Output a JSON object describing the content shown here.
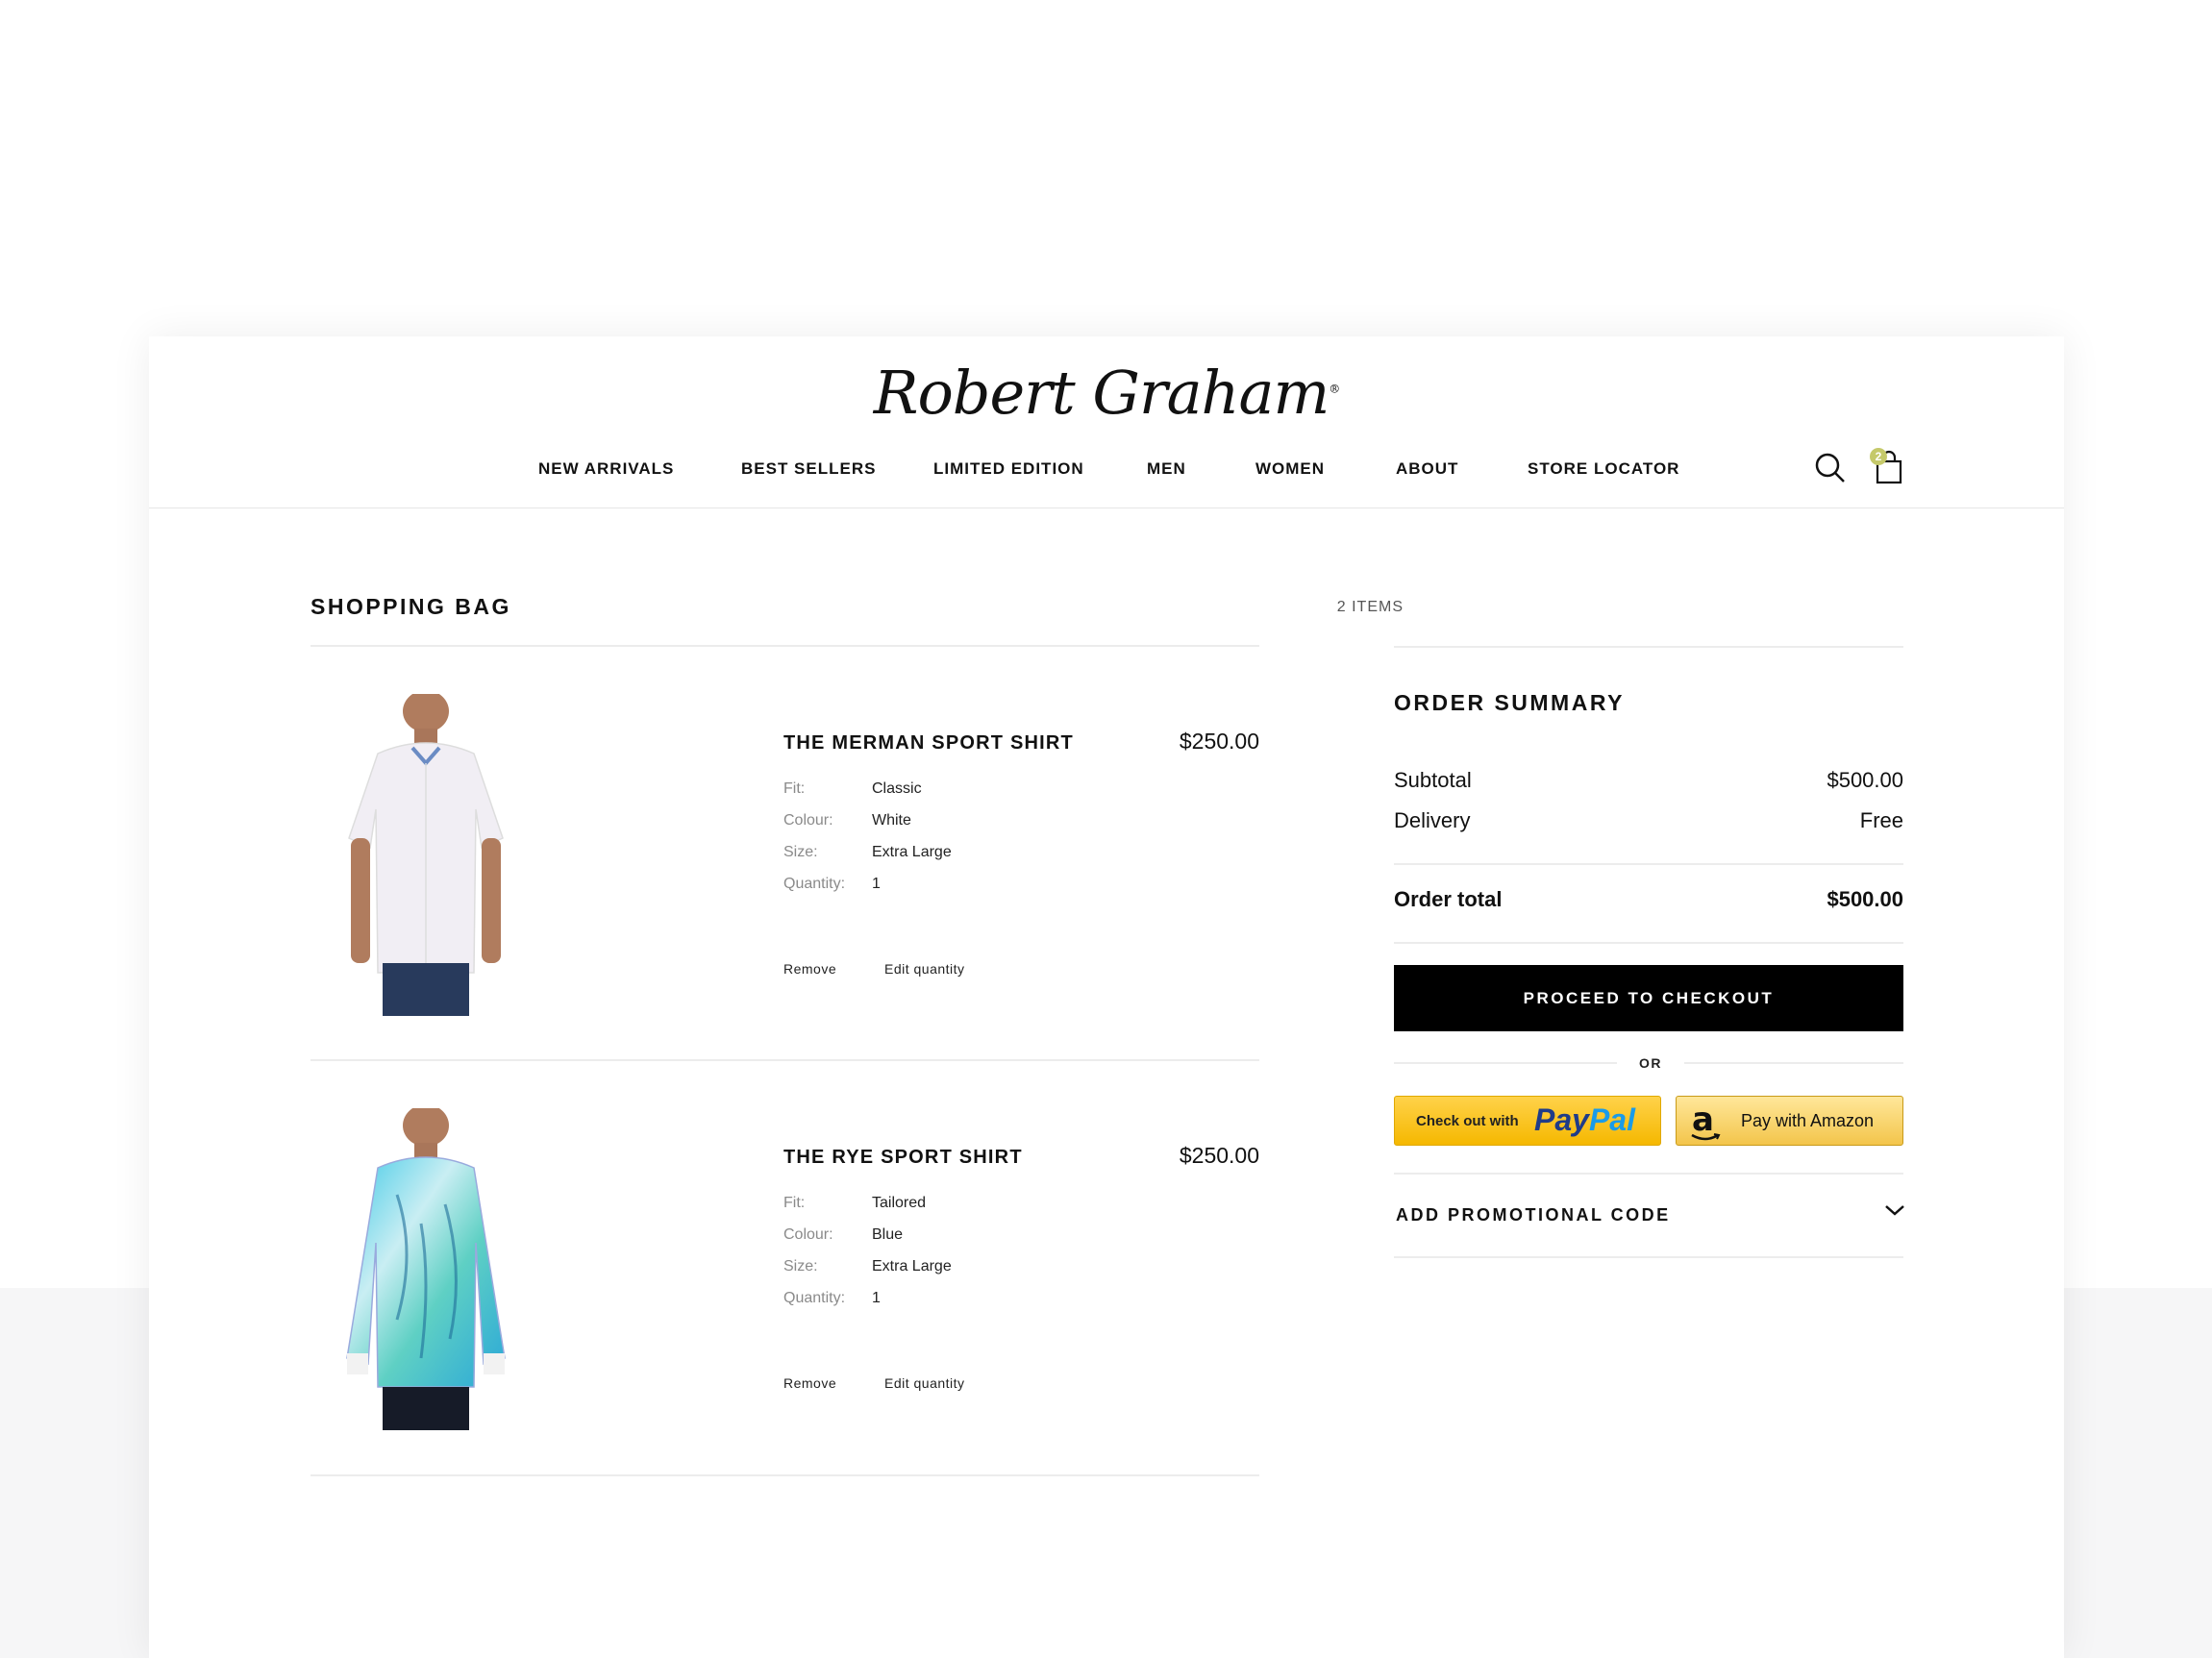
{
  "brand": {
    "logo_text": "Robert Graham"
  },
  "nav": {
    "items": [
      {
        "label": "NEW ARRIVALS"
      },
      {
        "label": "BEST SELLERS"
      },
      {
        "label": "LIMITED EDITION"
      },
      {
        "label": "MEN"
      },
      {
        "label": "WOMEN"
      },
      {
        "label": "ABOUT"
      },
      {
        "label": "STORE LOCATOR"
      }
    ],
    "search_icon": "search-icon",
    "bag_icon": "shopping-bag-icon",
    "bag_badge": "2"
  },
  "bag": {
    "title": "SHOPPING BAG",
    "count": "2 ITEMS",
    "labels": {
      "fit": "Fit:",
      "colour": "Colour:",
      "size": "Size:",
      "quantity": "Quantity:"
    },
    "remove_label": "Remove",
    "edit_label": "Edit quantity",
    "items": [
      {
        "name": "THE MERMAN SPORT SHIRT",
        "price": "$250.00",
        "fit": "Classic",
        "colour": "White",
        "size": "Extra Large",
        "quantity": "1"
      },
      {
        "name": "THE RYE SPORT SHIRT",
        "price": "$250.00",
        "fit": "Tailored",
        "colour": "Blue",
        "size": "Extra Large",
        "quantity": "1"
      }
    ]
  },
  "summary": {
    "title": "ORDER SUMMARY",
    "subtotal_label": "Subtotal",
    "subtotal_value": "$500.00",
    "delivery_label": "Delivery",
    "delivery_value": "Free",
    "total_label": "Order total",
    "total_value": "$500.00",
    "checkout_label": "PROCEED TO CHECKOUT",
    "or_label": "OR",
    "paypal_prefix": "Check out with",
    "paypal_pay": "Pay",
    "paypal_pal": "Pal",
    "amazon_label": "Pay with Amazon",
    "promo_label": "ADD PROMOTIONAL CODE"
  },
  "colors": {
    "accent_badge": "#c5c96a",
    "checkout_bg": "#000000",
    "paypal_yellow": "#f5b800",
    "paypal_blue": "#1f3c88"
  }
}
